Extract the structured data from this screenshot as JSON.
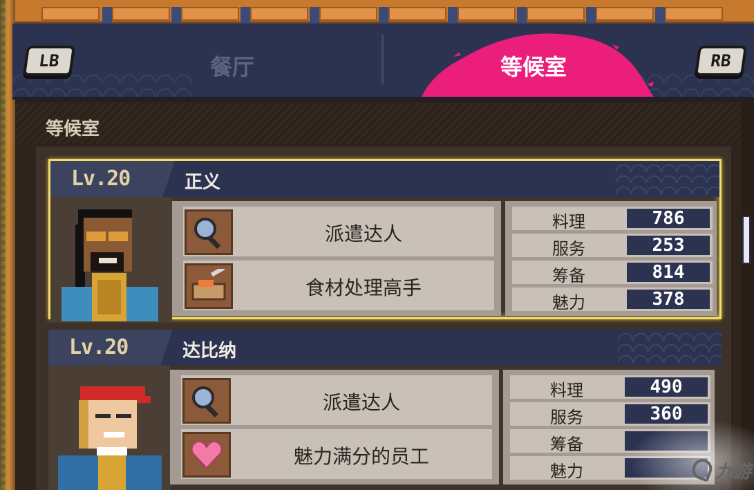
{
  "tabs": {
    "lb_label": "LB",
    "rb_label": "RB",
    "restaurant": "餐厅",
    "waiting_room": "等候室",
    "active_color": "#ec1e7c"
  },
  "section": {
    "title": "等候室"
  },
  "staff": [
    {
      "level": "Lv.20",
      "name": "正义",
      "selected": true,
      "skills": [
        {
          "label": "派遣达人",
          "icon": "magnifier-icon"
        },
        {
          "label": "食材处理高手",
          "icon": "cutting-board-icon"
        }
      ],
      "stats": [
        {
          "label": "料理",
          "value": "786"
        },
        {
          "label": "服务",
          "value": "253"
        },
        {
          "label": "筹备",
          "value": "814"
        },
        {
          "label": "魅力",
          "value": "378"
        }
      ]
    },
    {
      "level": "Lv.20",
      "name": "达比纳",
      "selected": false,
      "skills": [
        {
          "label": "派遣达人",
          "icon": "magnifier-icon"
        },
        {
          "label": "魅力满分的员工",
          "icon": "heart-icon"
        }
      ],
      "stats": [
        {
          "label": "料理",
          "value": "490"
        },
        {
          "label": "服务",
          "value": "360"
        },
        {
          "label": "筹备",
          "value": ""
        },
        {
          "label": "魅力",
          "value": ""
        }
      ]
    }
  ],
  "watermark": {
    "text": "九游"
  }
}
